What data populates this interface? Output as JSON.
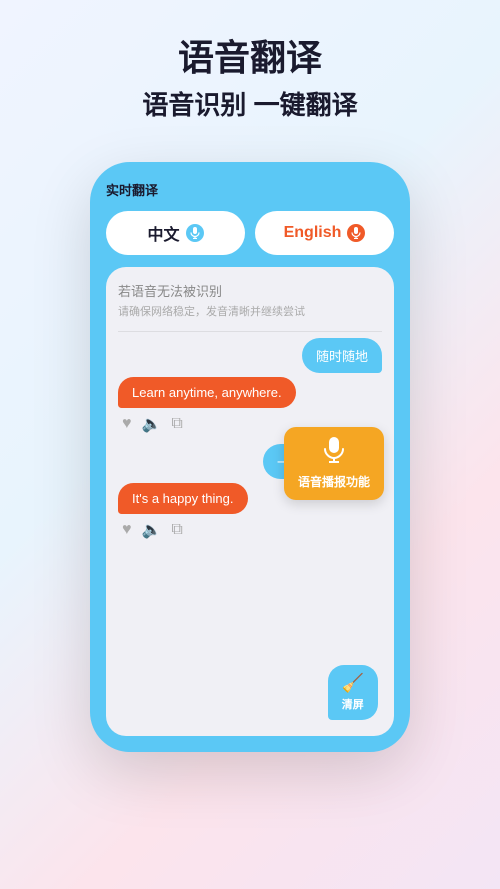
{
  "header": {
    "main_title": "语音翻译",
    "sub_title": "语音识别 一键翻译"
  },
  "phone": {
    "label": "实时翻译",
    "lang_chinese": "中文",
    "lang_english": "English",
    "recognition_hint": "若语音无法被识别",
    "recognition_sub": "请确保网络稳定，发音清晰并继续尝试",
    "msg1_right": "随时随地",
    "msg1_left": "Learn anytime, anywhere.",
    "msg2_right": "一件快乐的事。",
    "msg2_left": "It's a happy thing.",
    "tooltip_text": "语音播报功能",
    "clear_text": "清屏"
  }
}
